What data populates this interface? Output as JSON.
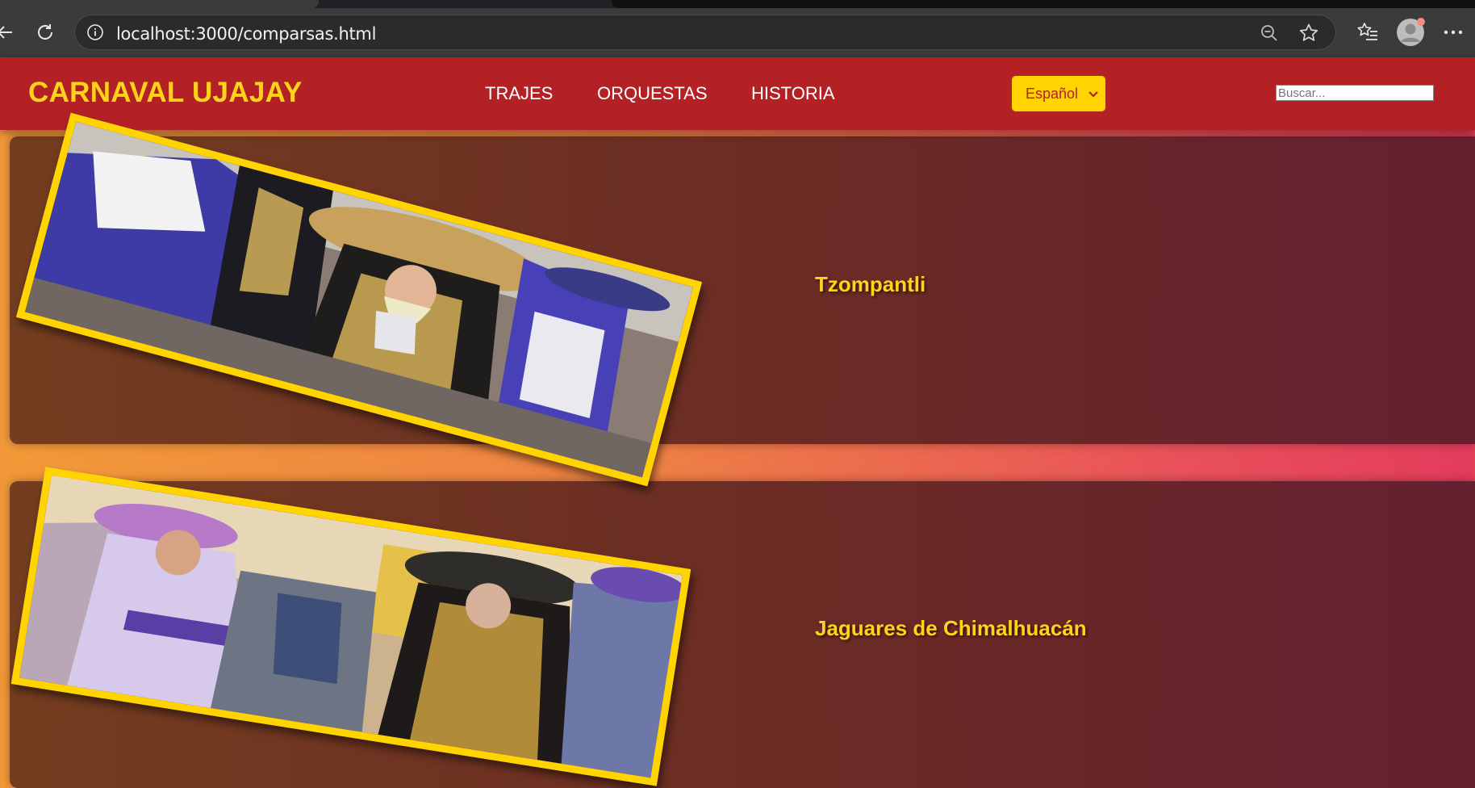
{
  "browser": {
    "url": "localhost:3000/comparsas.html",
    "icons": [
      "back-arrow-icon",
      "reload-icon",
      "info-icon",
      "zoom-out-icon",
      "star-icon",
      "favorites-icon",
      "profile-avatar-icon",
      "more-icon"
    ]
  },
  "site": {
    "brand": "CARNAVAL UJAJAY",
    "nav": [
      "TRAJES",
      "ORQUESTAS",
      "HISTORIA"
    ],
    "language": "Español",
    "search_placeholder": "Buscar..."
  },
  "comparsas": [
    {
      "name": "Tzompantli"
    },
    {
      "name": "Jaguares de Chimalhuacán"
    }
  ],
  "colors": {
    "header": "#b42125",
    "brand_text": "#ffd31a",
    "photo_frame": "#ffd400",
    "card_bg": "#6b2b25"
  }
}
